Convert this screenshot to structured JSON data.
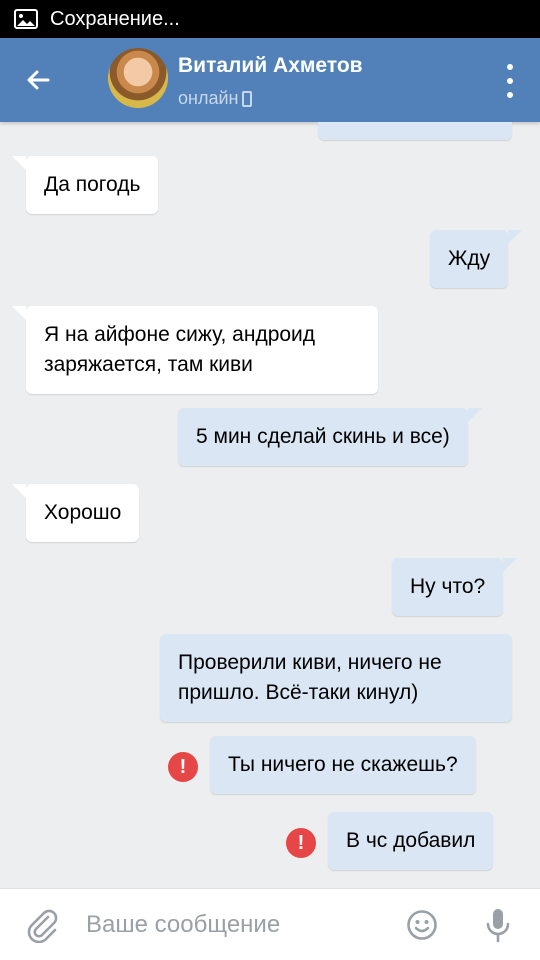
{
  "status_bar": {
    "text": "Сохранение..."
  },
  "header": {
    "name": "Виталий Ахметов",
    "status": "онлайн"
  },
  "messages": [
    {
      "dir": "out",
      "text": "",
      "partial": true
    },
    {
      "dir": "in",
      "text": "Да погодь"
    },
    {
      "dir": "out",
      "text": "Жду"
    },
    {
      "dir": "in",
      "text": "Я на айфоне сижу, андроид заряжается, там киви"
    },
    {
      "dir": "out",
      "text": "5 мин сделай скинь и все)"
    },
    {
      "dir": "in",
      "text": "Хорошо"
    },
    {
      "dir": "out",
      "text": "Ну что?"
    },
    {
      "dir": "out",
      "text": "Проверили киви, ничего не пришло. Всё-таки кинул)"
    },
    {
      "dir": "out",
      "text": "Ты ничего не скажешь?",
      "error": true
    },
    {
      "dir": "out",
      "text": "В чс добавил",
      "error": true
    }
  ],
  "input": {
    "placeholder": "Ваше сообщение"
  },
  "colors": {
    "header": "#5181b8",
    "outgoing": "#dae6f3",
    "incoming": "#ffffff",
    "error": "#e64646",
    "background": "#edeef0"
  },
  "icons": [
    "image-icon",
    "back-arrow-icon",
    "phone-icon",
    "more-vert-icon",
    "error-icon",
    "attach-icon",
    "emoji-icon",
    "mic-icon"
  ]
}
